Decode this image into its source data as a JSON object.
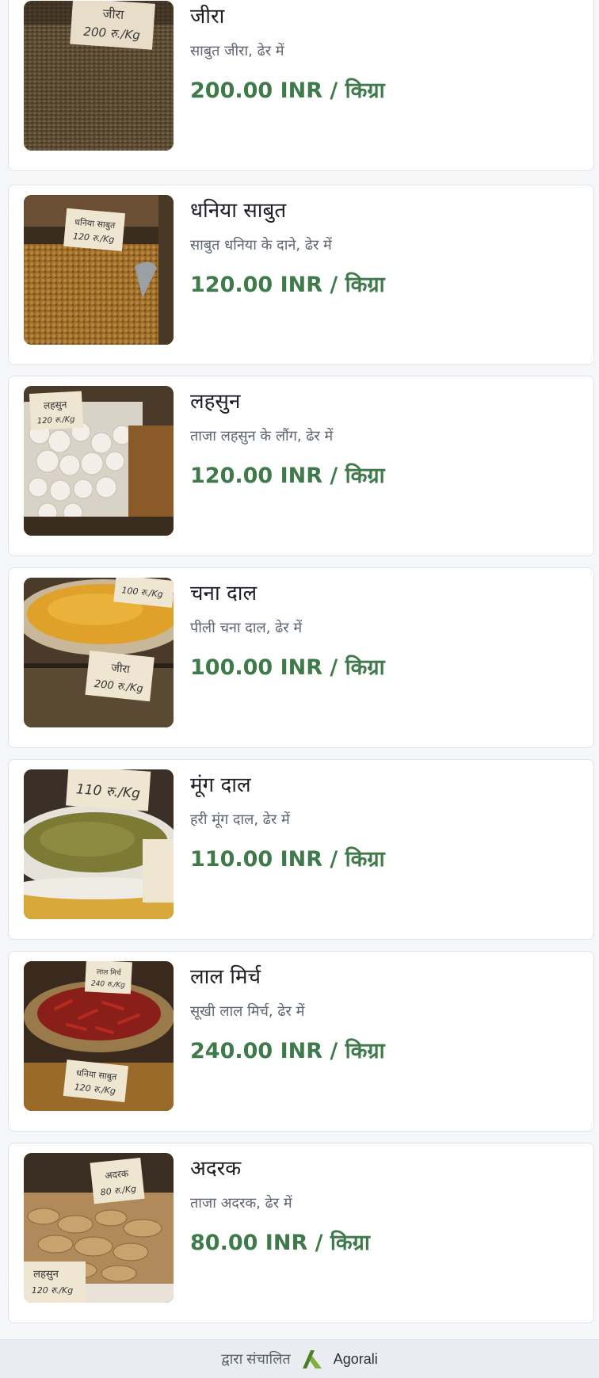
{
  "colors": {
    "price": "#3f7a4b",
    "card_background": "#ffffff",
    "page_background": "#f4f6f8",
    "logo_green": "#5e8c2b"
  },
  "products": [
    {
      "name": "जीरा",
      "description": "साबुत जीरा, ढेर में",
      "price": "200.00 INR / किग्रा",
      "image_icon": "cumin-seeds-photo"
    },
    {
      "name": "धनिया साबुत",
      "description": "साबुत धनिया के दाने, ढेर में",
      "price": "120.00 INR / किग्रा",
      "image_icon": "coriander-seeds-photo"
    },
    {
      "name": "लहसुन",
      "description": "ताजा लहसुन के लौंग, ढेर में",
      "price": "120.00 INR / किग्रा",
      "image_icon": "garlic-photo"
    },
    {
      "name": "चना दाल",
      "description": "पीली चना दाल, ढेर में",
      "price": "100.00 INR / किग्रा",
      "image_icon": "chana-dal-photo"
    },
    {
      "name": "मूंग दाल",
      "description": "हरी मूंग दाल, ढेर में",
      "price": "110.00 INR / किग्रा",
      "image_icon": "moong-dal-photo"
    },
    {
      "name": "लाल मिर्च",
      "description": "सूखी लाल मिर्च, ढेर में",
      "price": "240.00 INR / किग्रा",
      "image_icon": "red-chili-photo"
    },
    {
      "name": "अदरक",
      "description": "ताजा अदरक, ढेर में",
      "price": "80.00 INR / किग्रा",
      "image_icon": "ginger-photo"
    }
  ],
  "footer": {
    "powered_by": "द्वारा संचालित",
    "brand": "Agorali",
    "logo_icon": "agorali-logo-icon"
  },
  "image_labels": {
    "cumin_sign_line1": "जीरा",
    "cumin_sign_line2": "200 रु./Kg",
    "coriander_sign_line1": "धनिया साबुत",
    "coriander_sign_line2": "120 रु./Kg",
    "garlic_sign_line1": "लहसुन",
    "garlic_sign_line2": "120 रु./Kg",
    "chana_sign_top": "100 रु./Kg",
    "chana_sign_line1": "जीरा",
    "chana_sign_line2": "200 रु./Kg",
    "moong_sign_line1": "110 रु./Kg",
    "chili_sign_line1": "लाल मिर्च",
    "chili_sign_line2": "240 रु./Kg",
    "chili_sign2_line1": "धनिया साबुत",
    "chili_sign2_line2": "120 रु./Kg",
    "ginger_sign_line1": "अदरक",
    "ginger_sign_line2": "80 रु./Kg",
    "ginger_sign2_line1": "लहसुन",
    "ginger_sign2_line2": "120 रु./Kg"
  }
}
